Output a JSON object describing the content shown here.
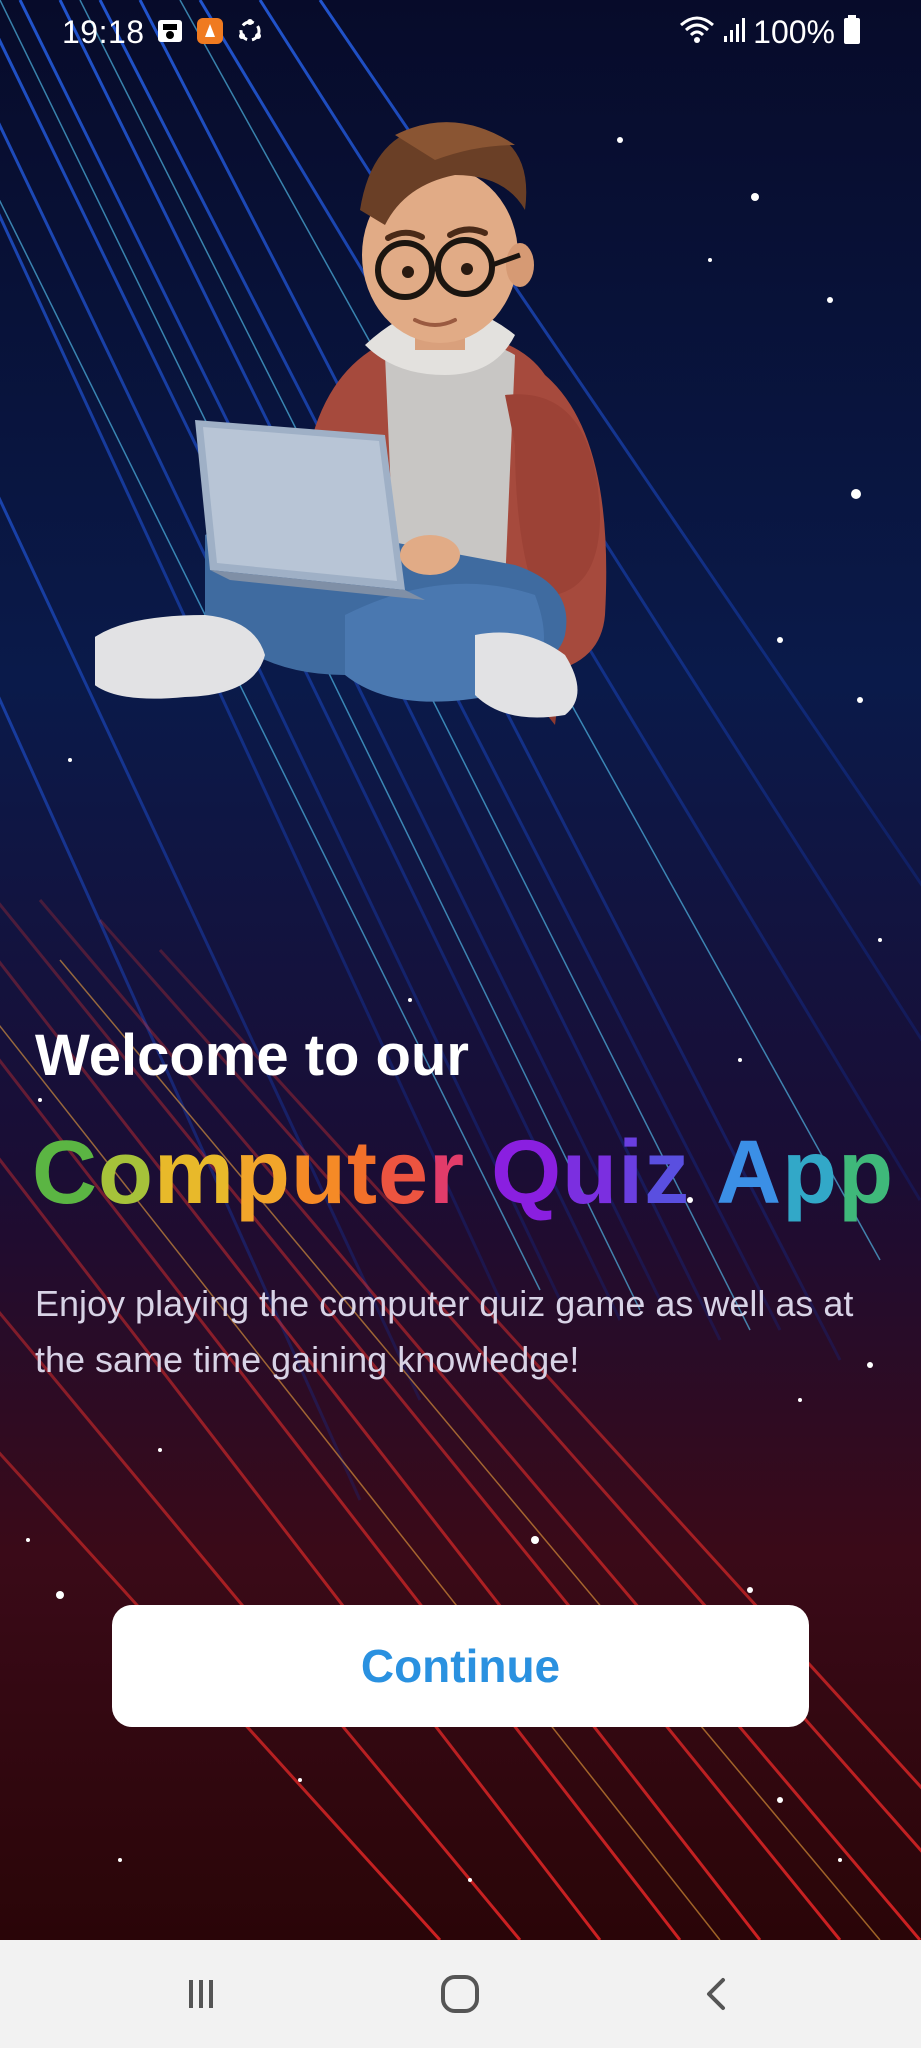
{
  "status_bar": {
    "time": "19:18",
    "battery": "100%",
    "icons": [
      "media-icon",
      "app-notification-icon",
      "sync-icon",
      "wifi-icon",
      "signal-icon",
      "battery-icon"
    ]
  },
  "hero": {
    "illustration": "student-with-laptop-illustration"
  },
  "welcome": {
    "line1": "Welcome to our",
    "title_letters": [
      {
        "ch": "C",
        "color": "#5bb543"
      },
      {
        "ch": "o",
        "color": "#a6c23a"
      },
      {
        "ch": "m",
        "color": "#e8b92a"
      },
      {
        "ch": "p",
        "color": "#f2a52a"
      },
      {
        "ch": "u",
        "color": "#f58a26"
      },
      {
        "ch": "t",
        "color": "#f2702a"
      },
      {
        "ch": "e",
        "color": "#ec5440"
      },
      {
        "ch": "r",
        "color": "#e23c6a"
      },
      {
        "ch": " ",
        "color": "#ffffff"
      },
      {
        "ch": "Q",
        "color": "#8a1fe0"
      },
      {
        "ch": "u",
        "color": "#7b2fe0"
      },
      {
        "ch": "i",
        "color": "#6a3ee0"
      },
      {
        "ch": "z",
        "color": "#5a4fe0"
      },
      {
        "ch": " ",
        "color": "#ffffff"
      },
      {
        "ch": "A",
        "color": "#3b8fe6"
      },
      {
        "ch": "p",
        "color": "#32a8c8"
      },
      {
        "ch": "p",
        "color": "#3fb87a"
      }
    ],
    "description": "Enjoy playing the computer quiz game as well as at the same time gaining knowledge!",
    "continue_label": "Continue",
    "continue_color": "#2a91e0"
  },
  "nav_bar": {
    "buttons": [
      "recent-apps-icon",
      "home-icon",
      "back-icon"
    ]
  }
}
